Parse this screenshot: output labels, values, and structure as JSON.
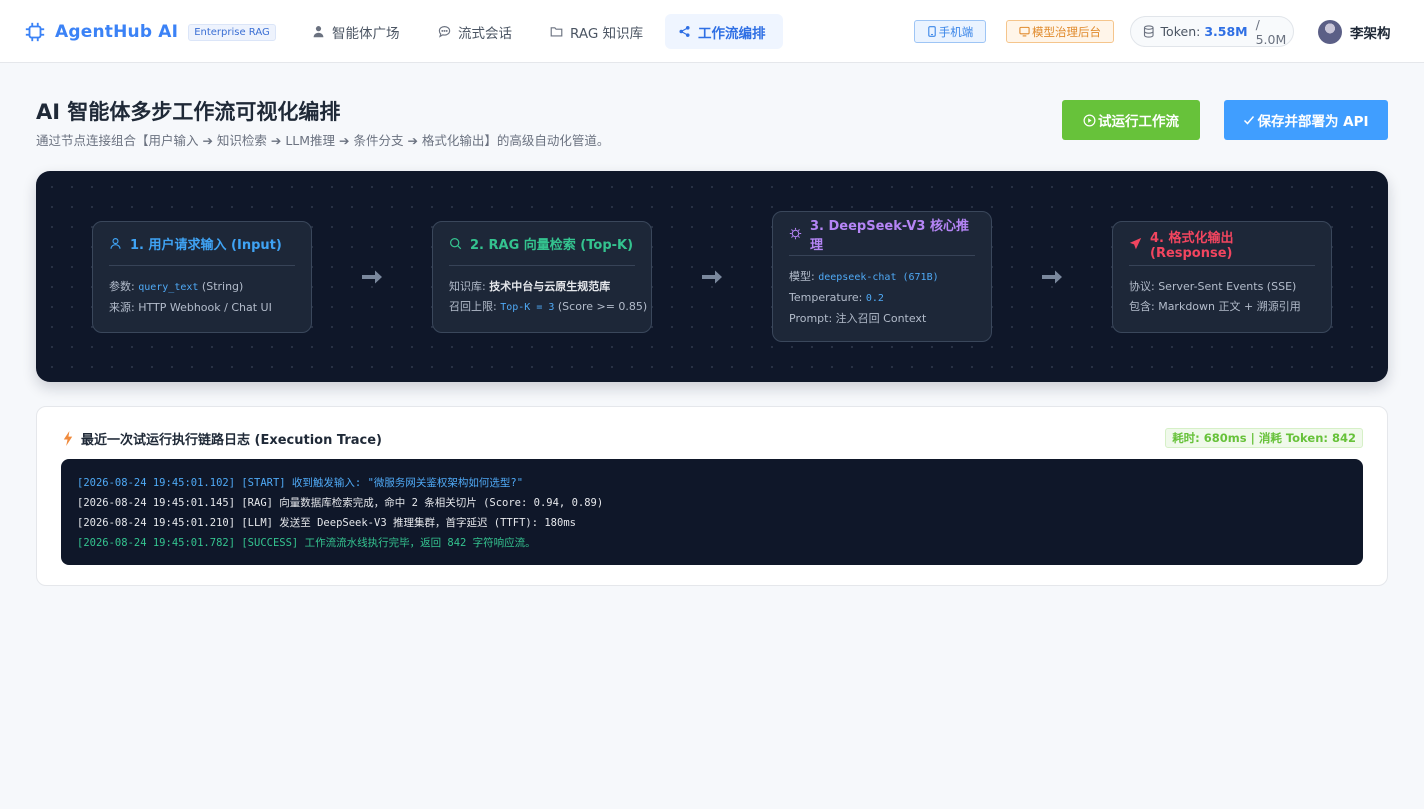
{
  "brand": {
    "name": "AgentHub AI",
    "tag": "Enterprise RAG"
  },
  "nav": {
    "items": [
      {
        "label": "智能体广场",
        "icon": "user-icon"
      },
      {
        "label": "流式会话",
        "icon": "chat-icon"
      },
      {
        "label": "RAG 知识库",
        "icon": "folder-icon"
      },
      {
        "label": "工作流编排",
        "icon": "share-icon",
        "active": true
      }
    ]
  },
  "header_right": {
    "mobile_label": "手机端",
    "admin_label": "模型治理后台",
    "token_label": "Token:",
    "token_used": "3.58M",
    "token_total": "/ 5.0M",
    "user_name": "李架构"
  },
  "page": {
    "title": "AI 智能体多步工作流可视化编排",
    "subtitle": "通过节点连接组合【用户输入 ➔ 知识检索 ➔ LLM推理 ➔ 条件分支 ➔ 格式化输出】的高级自动化管道。",
    "run_button": "试运行工作流",
    "deploy_button": "保存并部署为 API"
  },
  "nodes": [
    {
      "title": "1. 用户请求输入 (Input)",
      "lines": [
        {
          "label": "参数: ",
          "code": "query_text",
          "suffix": " (String)"
        },
        {
          "label": "来源: HTTP Webhook / Chat UI"
        }
      ]
    },
    {
      "title": "2. RAG 向量检索 (Top-K)",
      "lines": [
        {
          "label": "知识库: ",
          "strong": "技术中台与云原生规范库"
        },
        {
          "label": "召回上限: ",
          "code": "Top-K = 3",
          "suffix": " (Score >= 0.85)"
        }
      ]
    },
    {
      "title": "3. DeepSeek-V3 核心推理",
      "lines": [
        {
          "label": "模型: ",
          "code": "deepseek-chat (671B)"
        },
        {
          "label": "Temperature: ",
          "code": "0.2"
        },
        {
          "label": "Prompt: 注入召回 Context"
        }
      ]
    },
    {
      "title": "4. 格式化输出 (Response)",
      "lines": [
        {
          "label": "协议: Server-Sent Events (SSE)"
        },
        {
          "label": "包含: Markdown 正文 + 溯源引用"
        }
      ]
    }
  ],
  "trace": {
    "title": "最近一次试运行执行链路日志 (Execution Trace)",
    "badge": "耗时: 680ms | 消耗 Token: 842",
    "logs": [
      "[2026-08-24 19:45:01.102] [START] 收到触发输入: \"微服务网关鉴权架构如何选型?\"",
      "[2026-08-24 19:45:01.145] [RAG] 向量数据库检索完成，命中 2 条相关切片 (Score: 0.94, 0.89)",
      "[2026-08-24 19:45:01.210] [LLM] 发送至 DeepSeek-V3 推理集群，首字延迟 (TTFT): 180ms",
      "[2026-08-24 19:45:01.782] [SUCCESS] 工作流流水线执行完毕，返回 842 字符响应流。"
    ]
  },
  "colors": {
    "brand": "#3b82f6",
    "run_button": "#67c23a",
    "deploy_button": "#409eff",
    "canvas_bg": "#0f1729",
    "node1": "#3fa3f4",
    "node2": "#34c38f",
    "node3": "#b585f6",
    "node4": "#f2455f"
  }
}
